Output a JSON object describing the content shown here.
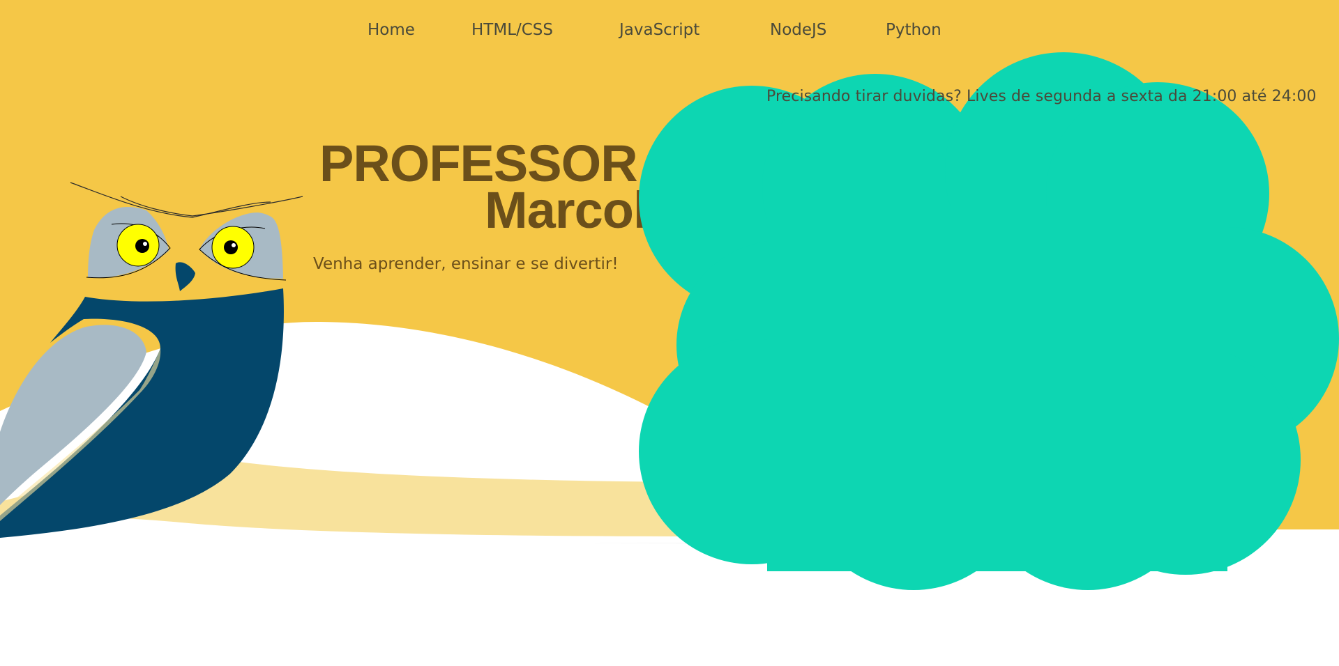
{
  "nav": {
    "items": [
      {
        "label": "Home"
      },
      {
        "label": "HTML/CSS"
      },
      {
        "label": "JavaScript"
      },
      {
        "label": "NodeJS"
      },
      {
        "label": "Python"
      }
    ]
  },
  "notice": {
    "text": "Precisando tirar duvidas? Lives de segunda a sexta da 21:00 até 24:00"
  },
  "hero": {
    "title_line_1": "PROFESSOR",
    "title_line_2": "Marcolan",
    "tagline": "Venha aprender, ensinar e se divertir!"
  },
  "illustration": {
    "owl_icon": "owl-icon",
    "cloud_icon": "cloud-icon"
  },
  "colors": {
    "background_yellow": "#f5c747",
    "light_yellow_band": "#f8e29c",
    "white_wave": "#ffffff",
    "title_brown": "#6b4f1a",
    "cloud_teal": "#0dd6b2",
    "owl_navy": "#04476b",
    "owl_gray": "#a8bac5",
    "owl_eye_yellow": "#ffff00",
    "nav_text": "#4a4a3a"
  }
}
